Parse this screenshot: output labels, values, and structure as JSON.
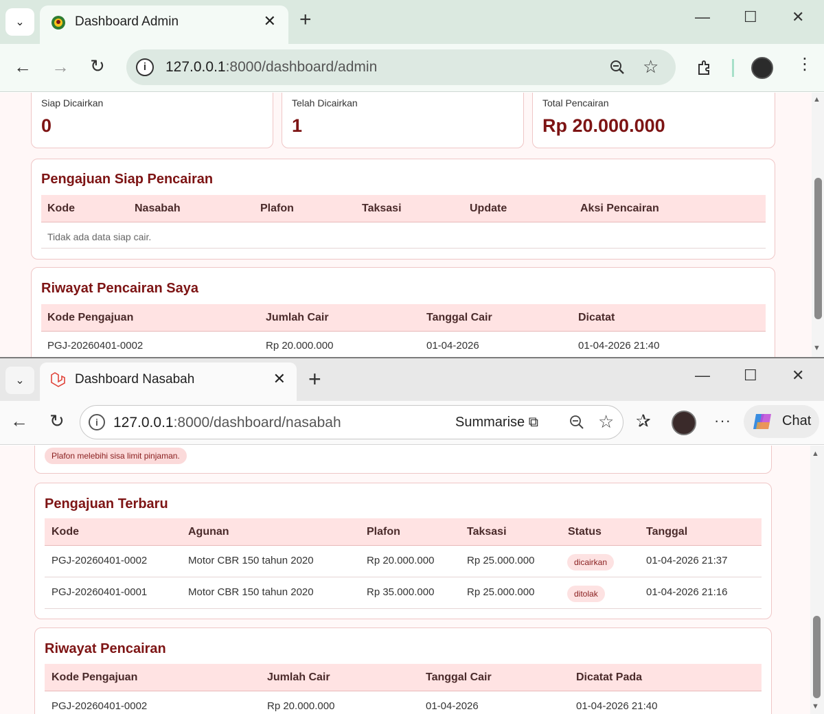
{
  "admin_window": {
    "tab_title": "Dashboard Admin",
    "url_host": "127.0.0.1",
    "url_rest": ":8000/dashboard/admin",
    "stats": [
      {
        "label": "Siap Dicairkan",
        "value": "0"
      },
      {
        "label": "Telah Dicairkan",
        "value": "1"
      },
      {
        "label": "Total Pencairan",
        "value": "Rp 20.000.000"
      }
    ],
    "siap_pencairan": {
      "title": "Pengajuan Siap Pencairan",
      "columns": [
        "Kode",
        "Nasabah",
        "Plafon",
        "Taksasi",
        "Update",
        "Aksi Pencairan"
      ],
      "empty_text": "Tidak ada data siap cair."
    },
    "riwayat": {
      "title": "Riwayat Pencairan Saya",
      "columns": [
        "Kode Pengajuan",
        "Jumlah Cair",
        "Tanggal Cair",
        "Dicatat"
      ],
      "rows": [
        [
          "PGJ-20260401-0002",
          "Rp 20.000.000",
          "01-04-2026",
          "01-04-2026 21:40"
        ]
      ]
    }
  },
  "nasabah_window": {
    "tab_title": "Dashboard Nasabah",
    "url_host": "127.0.0.1",
    "url_rest": ":8000/dashboard/nasabah",
    "summarise_label": "Summarise",
    "chat_label": "Chat",
    "alert_text": "Plafon melebihi sisa limit pinjaman.",
    "pengajuan_terbaru": {
      "title": "Pengajuan Terbaru",
      "columns": [
        "Kode",
        "Agunan",
        "Plafon",
        "Taksasi",
        "Status",
        "Tanggal"
      ],
      "rows": [
        [
          "PGJ-20260401-0002",
          "Motor CBR 150 tahun 2020",
          "Rp 20.000.000",
          "Rp 25.000.000",
          "dicairkan",
          "01-04-2026 21:37"
        ],
        [
          "PGJ-20260401-0001",
          "Motor CBR 150 tahun 2020",
          "Rp 35.000.000",
          "Rp 25.000.000",
          "ditolak",
          "01-04-2026 21:16"
        ]
      ]
    },
    "riwayat_pencairan": {
      "title": "Riwayat Pencairan",
      "columns": [
        "Kode Pengajuan",
        "Jumlah Cair",
        "Tanggal Cair",
        "Dicatat Pada"
      ],
      "rows": [
        [
          "PGJ-20260401-0002",
          "Rp 20.000.000",
          "01-04-2026",
          "01-04-2026 21:40"
        ]
      ]
    }
  },
  "colors": {
    "accent": "#7d1414",
    "table_header_bg": "#ffe3e3",
    "card_border": "#efc6c6"
  }
}
